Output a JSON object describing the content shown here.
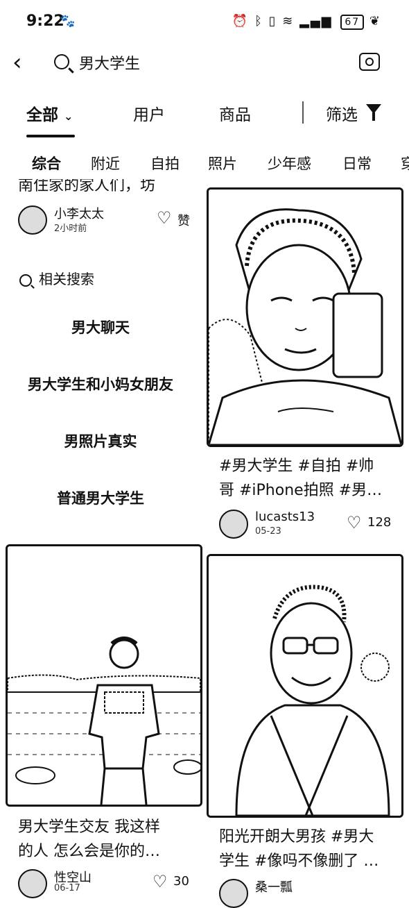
{
  "status_bar": {
    "time": "9:22",
    "app_icon": "paw-icon",
    "battery": "67"
  },
  "search": {
    "query": "男大学生"
  },
  "top_tabs": [
    {
      "label": "全部",
      "chevron": "chevron-down-icon"
    },
    {
      "label": "用户"
    },
    {
      "label": "商品"
    }
  ],
  "filter_label": "筛选",
  "sub_tabs": [
    "综合",
    "附近",
    "自拍",
    "照片",
    "少年感",
    "日常",
    "穿"
  ],
  "cards": {
    "top_left": {
      "title_partial": "南住家的家人们，坊",
      "user": "小李太太",
      "date": "2小时前",
      "like_label": "赞"
    },
    "top_right": {
      "title": "#男大学生 #自拍 #帅哥 #iPhone拍照 #男…",
      "title_l1": "#男大学生 #自拍 #帅",
      "title_l2": "哥 #iPhone拍照 #男…",
      "user": "lucasts13",
      "date": "05-23",
      "likes": "128"
    },
    "bottom_left": {
      "title_l1": "男大学生交友 我这样",
      "title_l2": "的人 怎么会是你的…",
      "user": "性空山",
      "date": "06-17",
      "likes": "30"
    },
    "bottom_right": {
      "title_l1": "阳光开朗大男孩 #男大",
      "title_l2": "学生 #像吗不像删了 …",
      "user": "桑一瓢"
    }
  },
  "related": {
    "heading": "相关搜索",
    "items": [
      "男大聊天",
      "男大学生和小妈女朋友",
      "男照片真实",
      "普通男大学生"
    ]
  }
}
